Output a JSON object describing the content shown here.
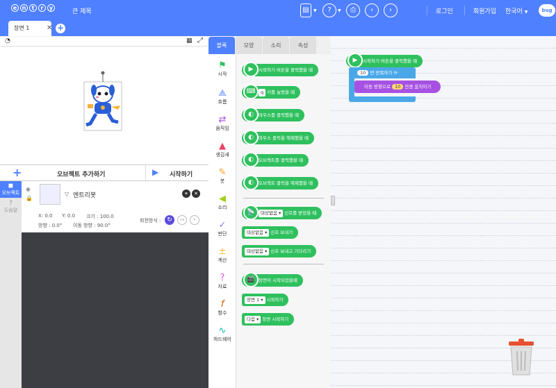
{
  "topbar": {
    "logo_letters": [
      "e",
      "n",
      "t",
      "r",
      "y"
    ],
    "project_title": "큰 제목",
    "login": "로그인",
    "signup": "회원가입",
    "language": "한국어",
    "bug_label": "bug"
  },
  "scene_tab": {
    "label": "장면 1"
  },
  "object_bar": {
    "add_object": "오브젝트 추가하기",
    "start": "시작하기"
  },
  "side_tabs": {
    "object": "오브젝트",
    "help": "도움말"
  },
  "object": {
    "name": "엔트리봇",
    "x": "X: 0.0",
    "y": "Y: 0.0",
    "size": "크기 : 100.0",
    "direction": "방향 : 0.0°",
    "move_direction": "이동 방향 : 90.0°",
    "rotation": "회전방식 :"
  },
  "palette_tabs": [
    "블록",
    "모양",
    "소리",
    "속성"
  ],
  "categories": [
    {
      "label": "시작",
      "icon": "flag-icon",
      "color": "#2fc05e"
    },
    {
      "label": "흐름",
      "icon": "flow-icon",
      "color": "#4f80ff"
    },
    {
      "label": "움직임",
      "icon": "move-icon",
      "color": "#a751e3"
    },
    {
      "label": "생김새",
      "icon": "looks-icon",
      "color": "#ec4466"
    },
    {
      "label": "붓",
      "icon": "brush-icon",
      "color": "#ff9e20"
    },
    {
      "label": "소리",
      "icon": "sound-icon",
      "color": "#a4d01d"
    },
    {
      "label": "판단",
      "icon": "judge-icon",
      "color": "#7c7cff"
    },
    {
      "label": "계산",
      "icon": "calc-icon",
      "color": "#ffd974"
    },
    {
      "label": "자료",
      "icon": "data-icon",
      "color": "#e457dc"
    },
    {
      "label": "함수",
      "icon": "function-icon",
      "color": "#de5c04"
    },
    {
      "label": "하드웨어",
      "icon": "hardware-icon",
      "color": "#00b6b1"
    }
  ],
  "palette_blocks": [
    "시작하기 버튼을 클릭했을 때",
    "키를 눌렀을 때",
    "마우스를 클릭했을 때",
    "마우스 클릭을 해제했을 때",
    "오브젝트를 클릭했을 때",
    "오브젝트 클릭을 해제했을 때",
    "신호를 받았을 때",
    "신호 보내기",
    "신호 보내고 기다리기",
    "장면이 시작되었을때",
    "시작하기",
    "장면 시작하기"
  ],
  "palette_dropdowns": {
    "signal": "대상없음",
    "scene": "장면 1",
    "next": "다음",
    "key": "q"
  },
  "workspace": {
    "start_block": "시작하기 버튼을 클릭했을 때",
    "repeat_count": "10",
    "repeat_label": "번 반복하기",
    "move_prefix": "이동 방향으로",
    "move_value": "10",
    "move_suffix": "만큼 움직이기"
  }
}
